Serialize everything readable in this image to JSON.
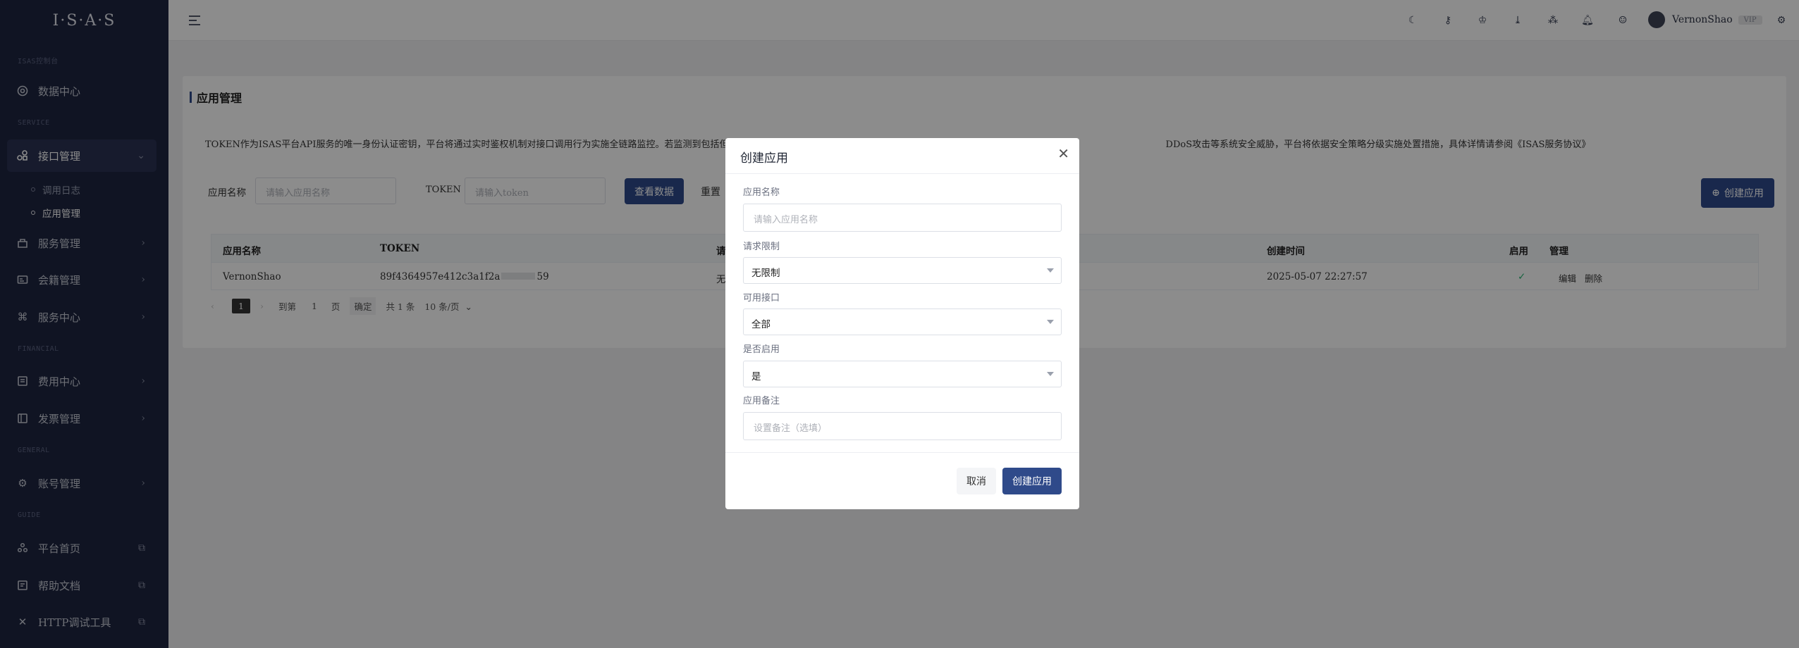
{
  "app": {
    "logo": "I·S·A·S"
  },
  "sidebar": {
    "sections": {
      "main": "ISAS控制台",
      "service": "SERVICE",
      "financial": "FINANCIAL",
      "general": "GENERAL",
      "guide": "GUIDE"
    },
    "items": [
      {
        "label": "数据中心",
        "icon": "dashboard-icon"
      },
      {
        "label": "接口管理",
        "icon": "api-icon"
      },
      {
        "label": "服务管理",
        "icon": "service-icon"
      },
      {
        "label": "会籍管理",
        "icon": "membership-icon"
      },
      {
        "label": "服务中心",
        "icon": "command-icon"
      },
      {
        "label": "费用中心",
        "icon": "billing-icon"
      },
      {
        "label": "发票管理",
        "icon": "invoice-icon"
      },
      {
        "label": "账号管理",
        "icon": "gear-icon"
      },
      {
        "label": "平台首页",
        "icon": "home-icon"
      },
      {
        "label": "帮助文档",
        "icon": "help-icon"
      },
      {
        "label": "HTTP调试工具",
        "icon": "tools-icon"
      }
    ],
    "subitems": [
      {
        "label": "调用日志"
      },
      {
        "label": "应用管理"
      }
    ]
  },
  "topbar": {
    "username": "VernonShao",
    "badge": "VIP"
  },
  "page": {
    "title": "应用管理",
    "notice_start": "TOKEN作为ISAS平台API服务的唯一身份认证密钥，平台将通过实时鉴权机制对接口调用行为实施全链路监控。若监测到包括但",
    "notice_end": "DDoS攻击等系统安全威胁，平台将依据安全策略分级实施处置措施，具体详情请参阅《ISAS服务协议》",
    "filters": {
      "name_label": "应用名称",
      "name_placeholder": "请输入应用名称",
      "token_label": "TOKEN",
      "token_placeholder": "请输入token",
      "search_button": "查看数据",
      "reset_button": "重置",
      "create_button": "创建应用"
    },
    "table": {
      "headers": {
        "name": "应用名称",
        "token": "TOKEN",
        "limit": "请",
        "created": "创建时间",
        "enabled": "启用",
        "manage": "管理"
      },
      "rows": [
        {
          "name": "VernonShao",
          "token_start": "89f4364957e412c3a1f2a",
          "token_end": "59",
          "limit": "无",
          "created": "2025-05-07 22:27:57",
          "edit": "编辑",
          "delete": "删除"
        }
      ]
    },
    "pager": {
      "current": "1",
      "goto": "到第",
      "page_input": "1",
      "page_unit": "页",
      "confirm": "确定",
      "total": "共 1 条",
      "size": "10 条/页"
    }
  },
  "modal": {
    "title": "创建应用",
    "name_label": "应用名称",
    "name_placeholder": "请输入应用名称",
    "limit_label": "请求限制",
    "limit_value": "无限制",
    "api_label": "可用接口",
    "api_value": "全部",
    "enabled_label": "是否启用",
    "enabled_value": "是",
    "remark_label": "应用备注",
    "remark_placeholder": "设置备注（选填）",
    "cancel": "取消",
    "submit": "创建应用"
  }
}
